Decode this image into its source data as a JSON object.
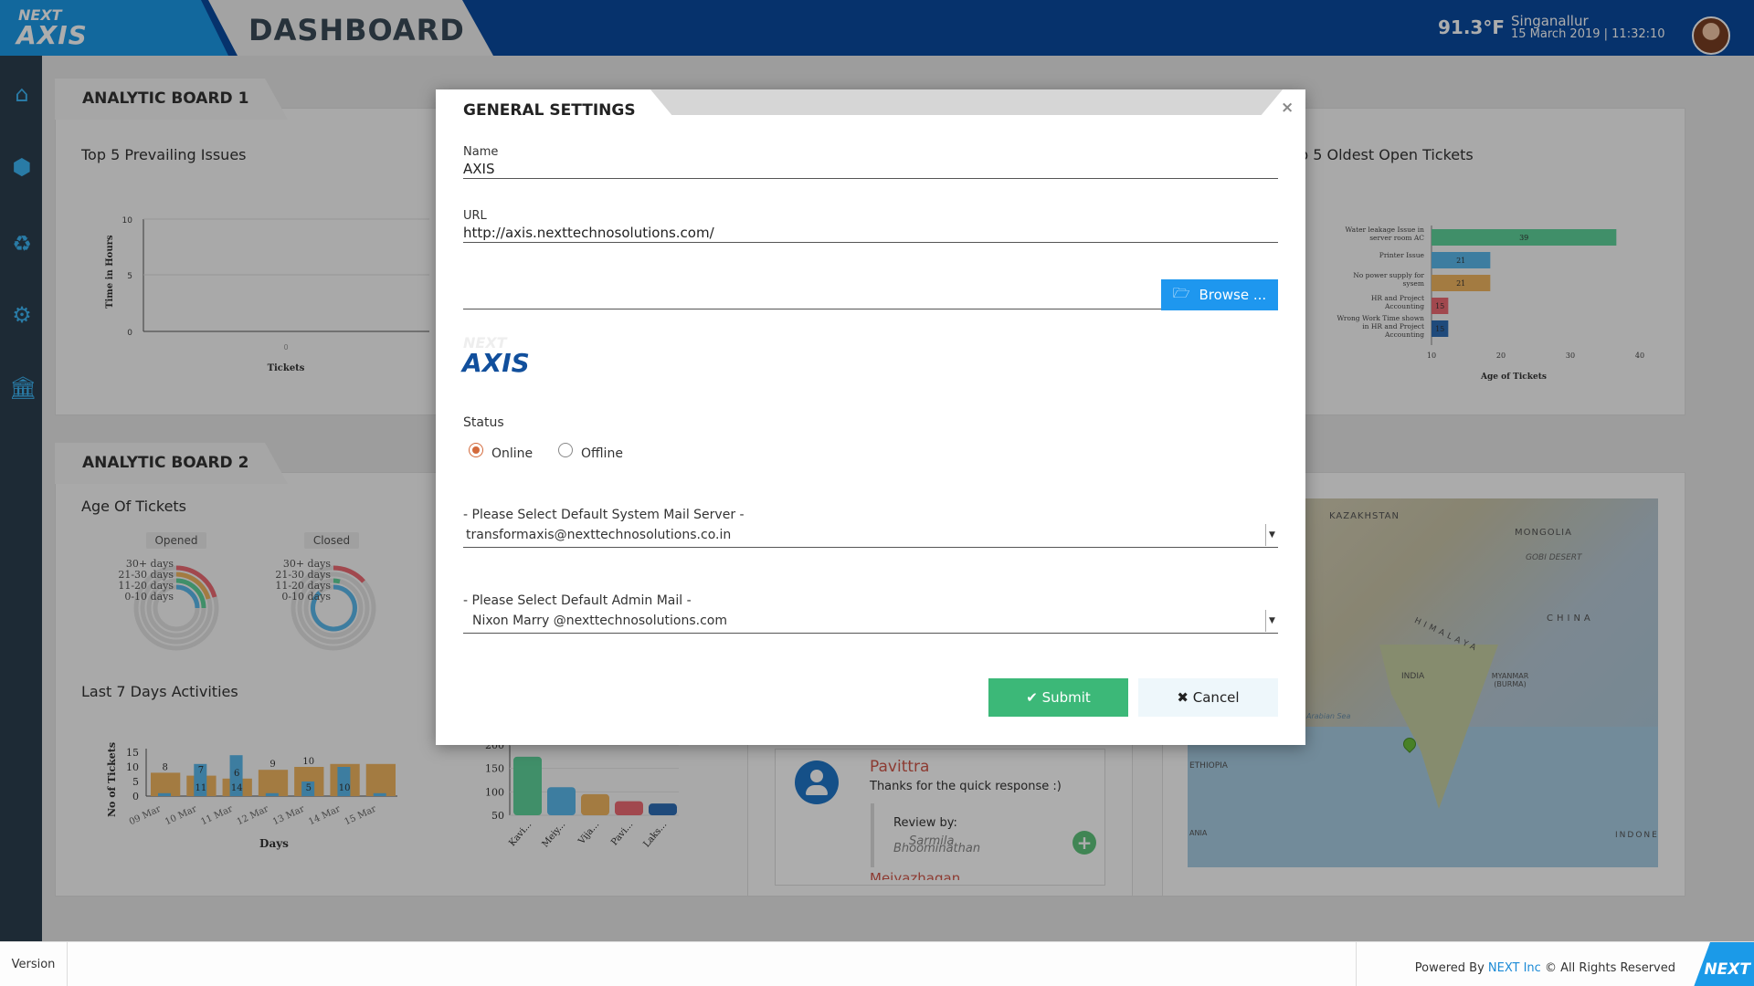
{
  "header": {
    "logo_next": "NEXT",
    "logo_axis": "AXIS",
    "title": "DASHBOARD",
    "temperature": "91.3°F",
    "location": "Singanallur",
    "datetime": "15 March 2019 | 11:32:10"
  },
  "sidebar": {
    "icons": [
      "home-icon",
      "cube-icon",
      "network-icon",
      "gear-icon",
      "bank-icon"
    ]
  },
  "board1": {
    "tab": "ANALYTIC BOARD 1",
    "left_title": "Top 5 Prevailing Issues",
    "left_ylabel": "Time in Hours",
    "left_xlabel": "Tickets",
    "left_ticks": [
      "10",
      "5",
      "0"
    ],
    "left_xtick": "0",
    "right_title": "p 5 Oldest Open Tickets",
    "right_xlabel": "Age of Tickets",
    "right_xticks": [
      "10",
      "20",
      "30",
      "40"
    ]
  },
  "board2": {
    "tab": "ANALYTIC BOARD 2",
    "age_title": "Age Of Tickets",
    "opened": "Opened",
    "closed": "Closed",
    "age_labels": [
      "30+ days",
      "21-30 days",
      "11-20 days",
      "0-10 days"
    ],
    "activities_title": "Last 7 Days Activities",
    "activities_ylabel": "No of Tickets",
    "activities_xlabel": "Days",
    "activities_yticks": [
      "15",
      "10",
      "5",
      "0"
    ],
    "bar_yticks": [
      "200",
      "150",
      "100",
      "50"
    ],
    "review_name": "Pavittra",
    "review_text": "Thanks for the quick response :)",
    "review_by": "Review by:",
    "review_sub1": "Sarmila",
    "review_sub2": "Bhoominathan",
    "review_next": "Meiyazhagan",
    "map_labels": [
      "KAZAKHSTAN",
      "MONGOLIA",
      "GOBI DESERT",
      "CHINA",
      "HIMALAYA",
      "INDIA",
      "MYANMAR (BURMA)",
      "Arabian Sea",
      "ETHIOPIA",
      "INDONES",
      "ANIA"
    ]
  },
  "chart_data": [
    {
      "type": "bar",
      "title": "p 5 Oldest Open Tickets",
      "xlabel": "Age of Tickets",
      "categories": [
        "Water leakage Issue in server room AC",
        "Printer Issue",
        "No power supply for sysem",
        "HR and Project Accounting",
        "Wrong Work Time shown in HR and Project Accounting"
      ],
      "values": [
        39,
        21,
        21,
        15,
        15
      ],
      "colors": [
        "#5fd39b",
        "#5ab9ec",
        "#f0b561",
        "#ee6a73",
        "#2f6db5"
      ],
      "xlim": [
        10,
        40
      ]
    },
    {
      "type": "bar",
      "title": "Last 7 Days Activities",
      "xlabel": "Days",
      "ylabel": "No of Tickets",
      "categories": [
        "09 Mar",
        "10 Mar",
        "11 Mar",
        "12 Mar",
        "13 Mar",
        "14 Mar",
        "15 Mar"
      ],
      "series": [
        {
          "values": [
            8,
            7,
            6,
            9,
            10,
            11,
            11
          ]
        },
        {
          "values": [
            1,
            11,
            14,
            1,
            5,
            10,
            1
          ]
        }
      ],
      "data_labels": [
        "8",
        "7",
        "11",
        "6",
        "14",
        "9",
        "10",
        "5",
        "10"
      ],
      "ylim": [
        0,
        15
      ]
    },
    {
      "type": "bar",
      "categories": [
        "Kavi...",
        "Meiy...",
        "Vija...",
        "Pavi...",
        "Laks..."
      ],
      "values": [
        175,
        110,
        95,
        80,
        75
      ],
      "colors": [
        "#5fd39b",
        "#5ab9ec",
        "#f0b561",
        "#ee6a73",
        "#2f6db5"
      ],
      "ylim": [
        50,
        200
      ]
    }
  ],
  "modal": {
    "title": "GENERAL SETTINGS",
    "close": "×",
    "name_label": "Name",
    "name_value": "AXIS",
    "url_label": "URL",
    "url_value": "http://axis.nexttechnosolutions.com/",
    "browse_label": "Browse ...",
    "preview_next": "NEXT",
    "preview_axis": "AXIS",
    "status_label": "Status",
    "online": "Online",
    "offline": "Offline",
    "status_selected": "Online",
    "mail_server_label": "- Please Select Default System Mail Server -",
    "mail_server_value": "transformaxis@nexttechnosolutions.co.in",
    "admin_mail_label": "- Please Select Default Admin Mail -",
    "admin_mail_value": "Nixon Marry @nexttechnosolutions.com",
    "submit": "Submit",
    "cancel": "Cancel"
  },
  "footer": {
    "version": "Version",
    "powered_prefix": "Powered By ",
    "powered_link": "NEXT Inc",
    "powered_suffix": " © All Rights Reserved",
    "corner_logo": "NEXT"
  }
}
